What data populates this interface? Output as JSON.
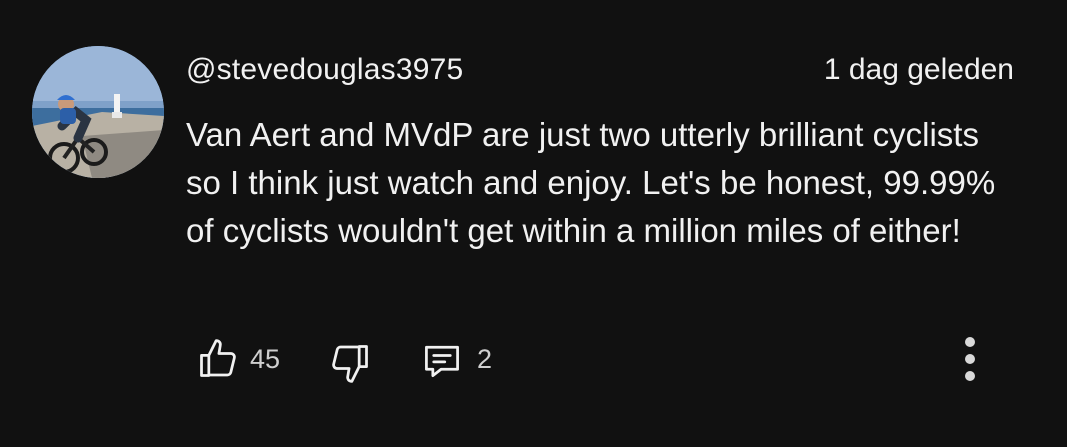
{
  "comment": {
    "username": "@stevedouglas3975",
    "timestamp": "1 dag geleden",
    "text": "Van Aert and MVdP are just two utterly brilliant cyclists so I think just watch and enjoy. Let's be honest, 99.99% of cyclists wouldn't get within a million miles of either!"
  },
  "actions": {
    "like_count": "45",
    "reply_count": "2"
  },
  "icons": {
    "like": "thumbs-up-icon",
    "dislike": "thumbs-down-icon",
    "reply": "comment-icon",
    "more": "more-vertical-icon"
  },
  "colors": {
    "background": "#111111",
    "text": "#f1f1f1",
    "secondary": "#cfcfcf"
  }
}
